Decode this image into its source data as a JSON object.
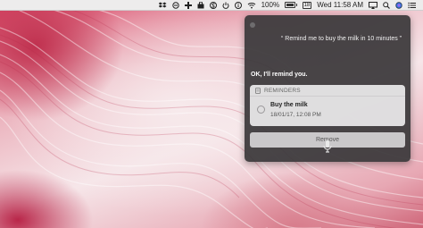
{
  "menubar": {
    "battery_percent": "100%",
    "calendar_day": "18",
    "clock": "Wed 11:58 AM",
    "icons": [
      "dropbox-icon",
      "circle-icon",
      "cross-icon",
      "bag-icon",
      "s-icon",
      "power-icon",
      "info-icon",
      "wifi-icon",
      "battery-icon",
      "calendar-icon",
      "airplay-icon",
      "spotlight-icon",
      "siri-icon",
      "notification-center-icon"
    ]
  },
  "siri": {
    "query_text": "“ Remind me to buy the milk in 10 minutes ”",
    "response_text": "OK, I'll remind you.",
    "reminders_card": {
      "header": "REMINDERS",
      "item": {
        "title": "Buy the milk",
        "date": "18/01/17, 12:08 PM"
      }
    },
    "remove_label": "Remove"
  },
  "colors": {
    "siri_panel": "#3a383a",
    "card_bg": "#ebe9eb",
    "wallpaper_primary": "#d94a68",
    "wallpaper_light": "#f6e6e9"
  }
}
